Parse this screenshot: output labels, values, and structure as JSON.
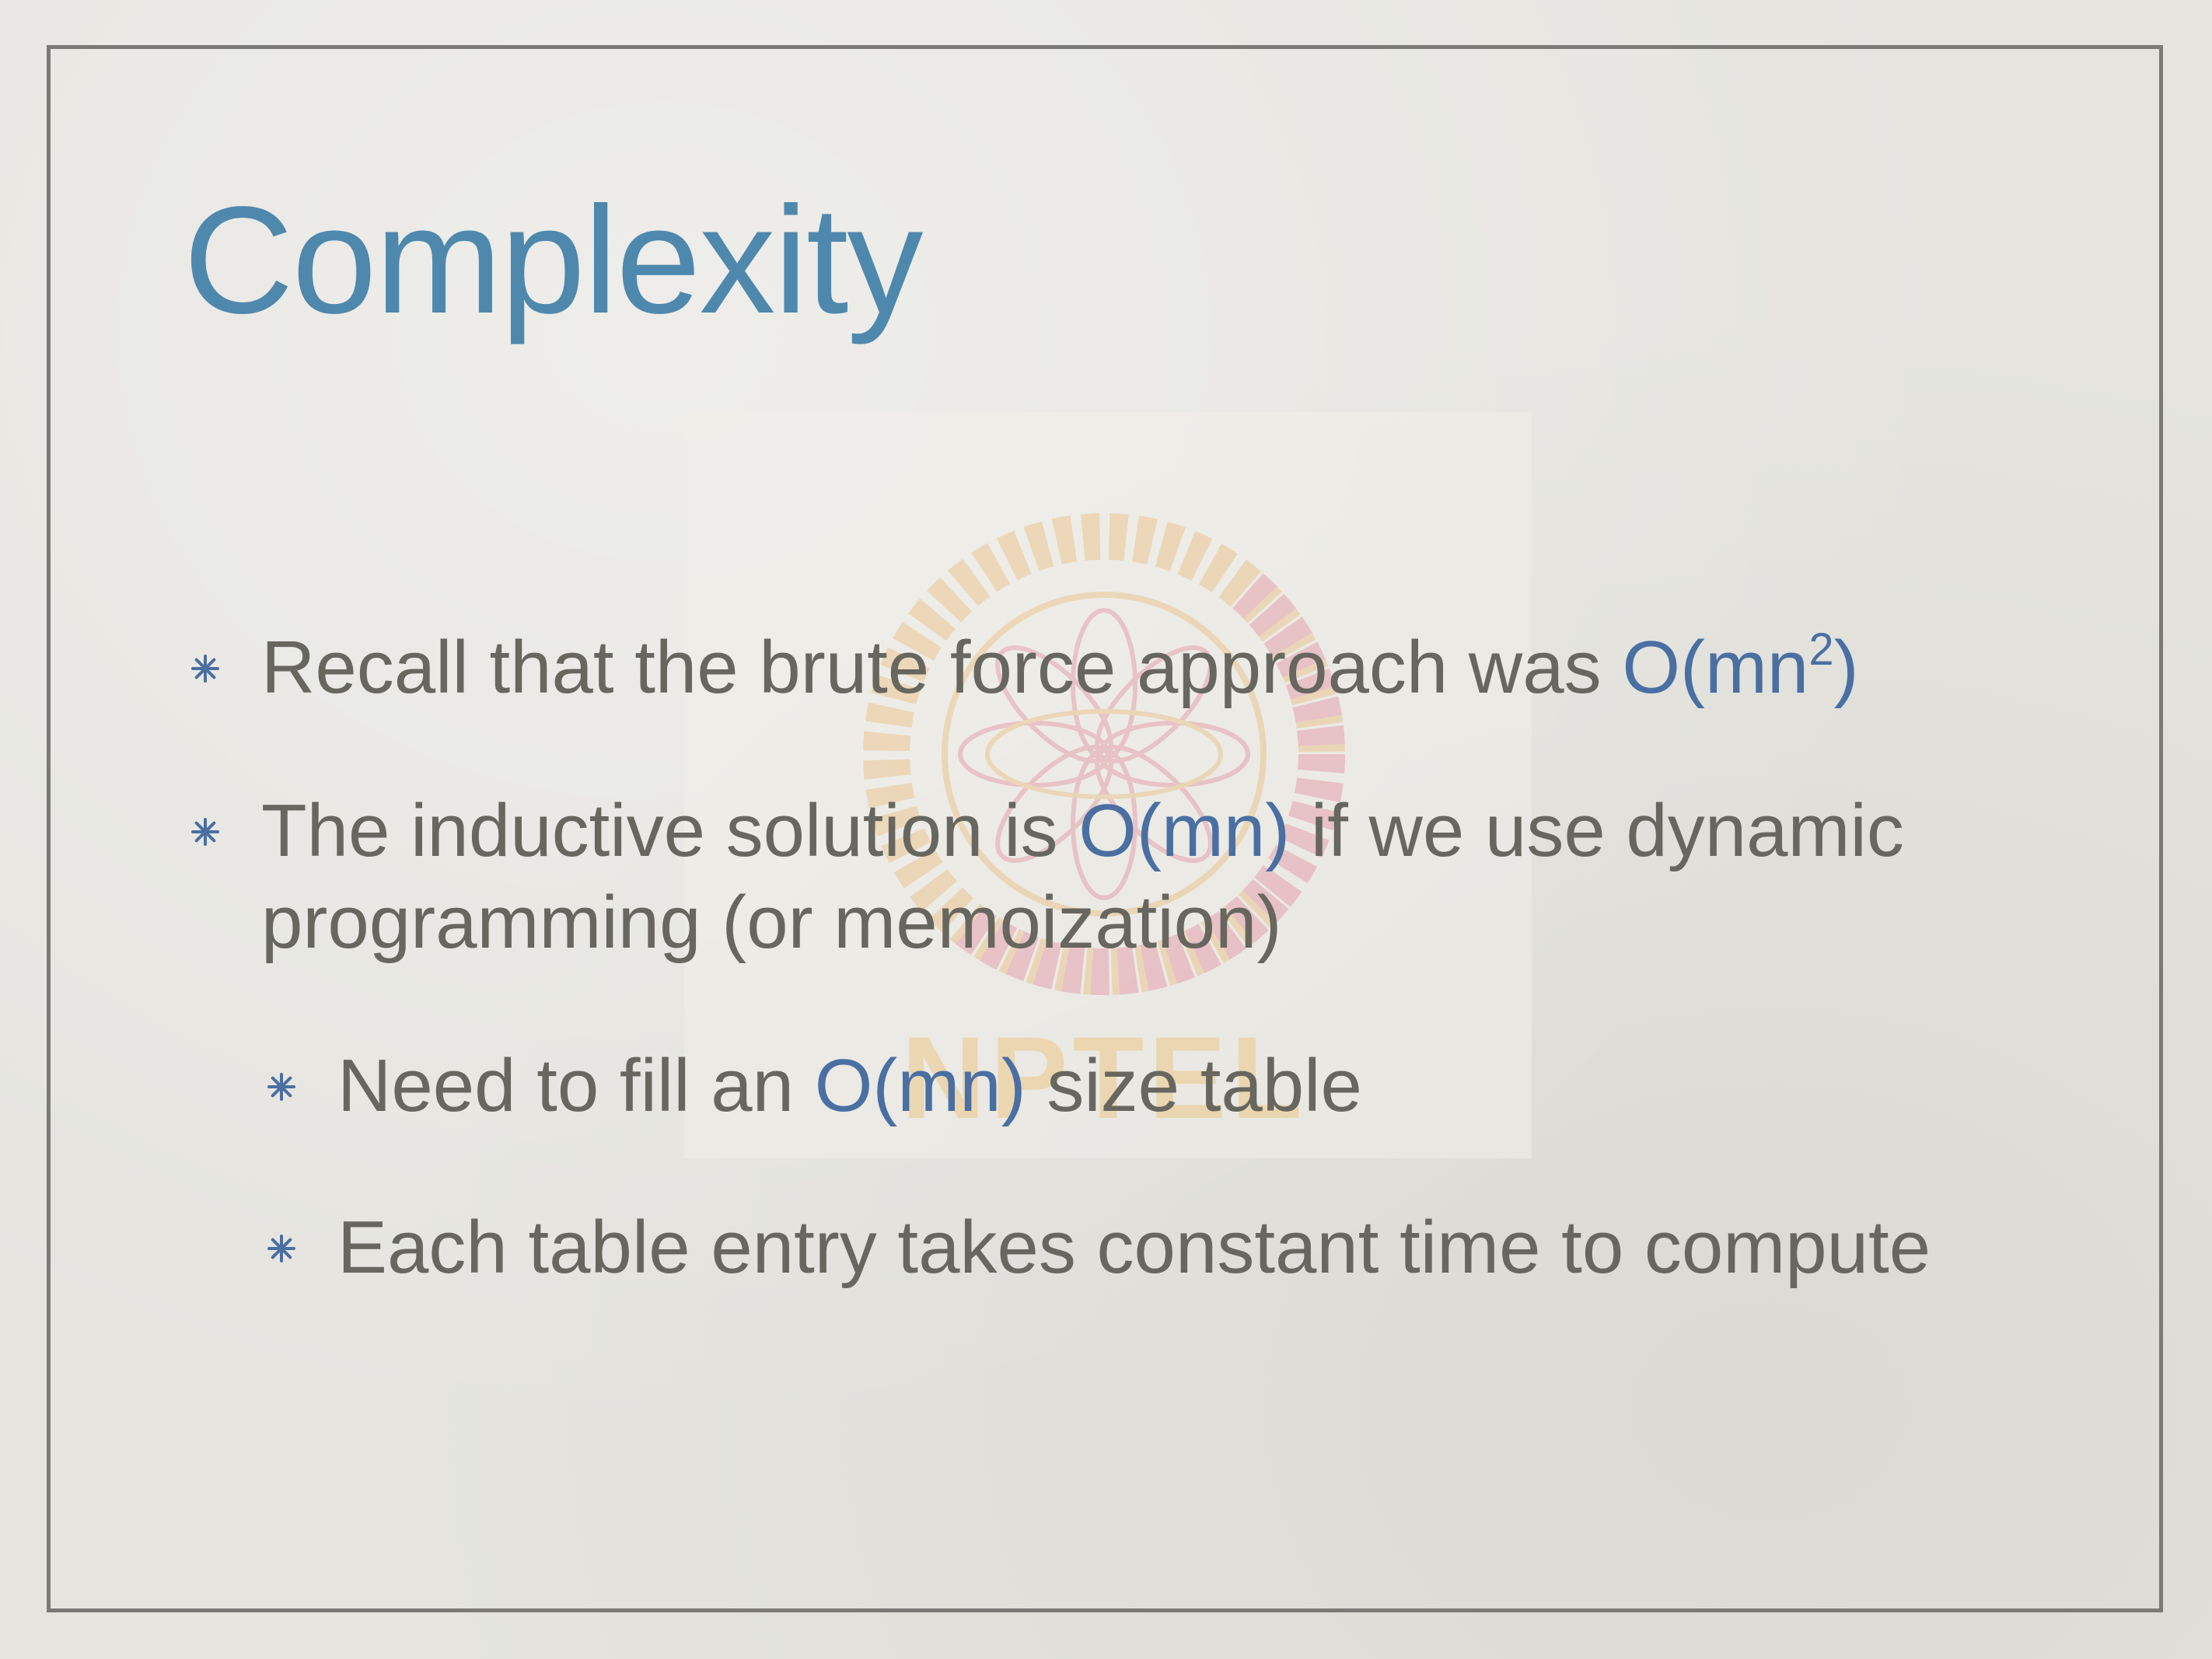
{
  "slide": {
    "title": "Complexity",
    "watermark": {
      "text": "NPTEL",
      "colors": {
        "orange": "#e9b264",
        "pink": "#e07a8d"
      }
    },
    "bullets": [
      {
        "level": 1,
        "parts": [
          "Recall that the brute force approach was ",
          "O(mn",
          "2",
          ")"
        ]
      },
      {
        "level": 1,
        "line1": [
          "The inductive solution is ",
          "O(mn)",
          " if we use dynamic"
        ],
        "line2": "programming (or memoization)"
      },
      {
        "level": 2,
        "parts": [
          "Need to fill an ",
          "O(mn)",
          " size table"
        ]
      },
      {
        "level": 2,
        "parts": [
          "Each table entry takes constant time to compute"
        ]
      }
    ],
    "colors": {
      "title": "#4f88ad",
      "body": "#67665f",
      "highlight": "#4a6fa2",
      "bullet": "#4a6fa2",
      "frame": "#7b7a76"
    },
    "bullet_icon": "asterisk-bullet-icon"
  }
}
